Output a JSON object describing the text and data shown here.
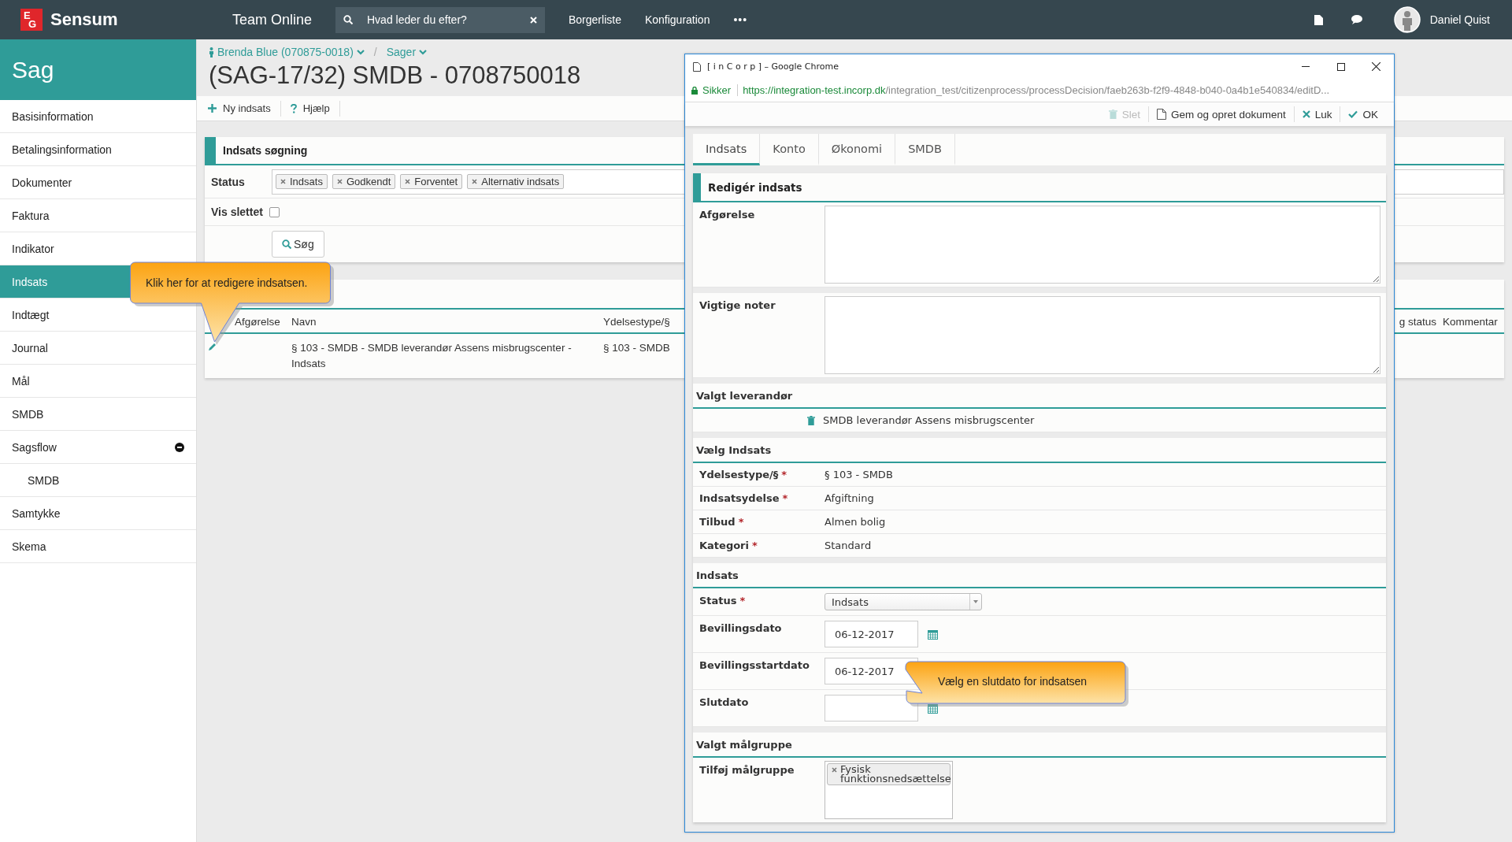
{
  "app": {
    "logo_mark": [
      "E",
      "G"
    ],
    "logo": "Sensum",
    "title": "Team Online"
  },
  "search": {
    "placeholder": "Hvad leder du efter?"
  },
  "nav": [
    {
      "label": "Borgerliste"
    },
    {
      "label": "Konfiguration"
    }
  ],
  "more": "•••",
  "user": {
    "name": "Daniel Quist"
  },
  "sidebar": {
    "title": "Sag",
    "items": [
      {
        "label": "Basisinformation",
        "selected": false
      },
      {
        "label": "Betalingsinformation",
        "selected": false
      },
      {
        "label": "Dokumenter",
        "selected": false
      },
      {
        "label": "Faktura",
        "selected": false
      },
      {
        "label": "Indikator",
        "selected": false
      },
      {
        "label": "Indsats",
        "selected": true
      },
      {
        "label": "Indtægt",
        "selected": false
      },
      {
        "label": "Journal",
        "selected": false
      },
      {
        "label": "Mål",
        "selected": false
      },
      {
        "label": "SMDB",
        "selected": false
      },
      {
        "label": "Sagsflow",
        "selected": false,
        "expanded": true,
        "children": [
          {
            "label": "SMDB",
            "selected": false
          }
        ]
      },
      {
        "label": "Samtykke",
        "selected": false
      },
      {
        "label": "Skema",
        "selected": false
      }
    ]
  },
  "breadcrumbs": [
    {
      "label": "Brenda Blue (070875-0018)",
      "kind": "person"
    },
    {
      "label": "Sager",
      "kind": "plain"
    }
  ],
  "breadcrumb_separator": "/",
  "page_title": "(SAG-17/32) SMDB - 0708750018",
  "toolbar": [
    {
      "label": "Ny indsats",
      "kind": "add"
    },
    {
      "label": "Hjælp",
      "kind": "help"
    }
  ],
  "search_panel": {
    "title": "Indsats søgning",
    "status_label": "Status",
    "status_tags": [
      "Indsats",
      "Godkendt",
      "Forventet",
      "Alternativ indsats"
    ],
    "show_deleted_label": "Vis slettet",
    "show_deleted": false,
    "search_button": "Søg"
  },
  "results": {
    "columns": [
      "Afgørelse",
      "Navn",
      "Ydelsestype/§",
      "g status",
      "Kommentar"
    ],
    "rows": [
      {
        "name": "§ 103 - SMDB - SMDB leverandør Assens misbrugscenter - Indsats",
        "type": "§ 103 - SMDB"
      }
    ]
  },
  "tooltips": [
    {
      "text": "Klik her for at redigere indsatsen."
    },
    {
      "text": "Vælg en slutdato for indsatsen"
    }
  ],
  "popup": {
    "title": "[ i n C o r p ] – Google Chrome",
    "secure_label": "Sikker",
    "url_host": "https://integration-test.incorp.dk",
    "url_path": "/integration_test/citizenprocess/processDecision/faeb263b-f2f9-4848-b040-0a4b1e540834/editD...",
    "actions": [
      {
        "label": "Slet",
        "kind": "delete",
        "disabled": true
      },
      {
        "label": "Gem og opret dokument",
        "kind": "document",
        "disabled": false
      },
      {
        "label": "Luk",
        "kind": "close",
        "disabled": false
      },
      {
        "label": "OK",
        "kind": "ok",
        "disabled": false
      }
    ],
    "tabs": [
      {
        "label": "Indsats",
        "selected": true
      },
      {
        "label": "Konto",
        "selected": false
      },
      {
        "label": "Økonomi",
        "selected": false
      },
      {
        "label": "SMDB",
        "selected": false
      }
    ],
    "required_mark": "*",
    "form": {
      "title": "Redigér indsats",
      "rows": [
        {
          "kind": "textarea",
          "label": "Afgørelse"
        },
        {
          "kind": "textarea",
          "label": "Vigtige noter"
        },
        {
          "kind": "heading",
          "label": "Valgt leverandør"
        },
        {
          "kind": "provider",
          "value": "SMDB leverandør Assens misbrugscenter"
        },
        {
          "kind": "heading",
          "label": "Vælg Indsats"
        },
        {
          "kind": "text",
          "label": "Ydelsestype/§",
          "required": true,
          "value": "§ 103 - SMDB"
        },
        {
          "kind": "text",
          "label": "Indsatsydelse",
          "required": true,
          "value": "Afgiftning"
        },
        {
          "kind": "text",
          "label": "Tilbud",
          "required": true,
          "value": "Almen bolig"
        },
        {
          "kind": "text",
          "label": "Kategori",
          "required": true,
          "value": "Standard"
        },
        {
          "kind": "heading",
          "label": "Indsats"
        },
        {
          "kind": "select",
          "label": "Status",
          "required": true,
          "value": "Indsats"
        },
        {
          "kind": "date",
          "label": "Bevillingsdato",
          "required": false,
          "value": "06-12-2017"
        },
        {
          "kind": "date",
          "label": "Bevillingsstartdato",
          "required": false,
          "value": "06-12-2017"
        },
        {
          "kind": "date",
          "label": "Slutdato",
          "required": false
        },
        {
          "kind": "heading",
          "label": "Valgt målgruppe"
        },
        {
          "kind": "tags",
          "label": "Tilføj målgruppe",
          "required": false,
          "tags": [
            "Fysisk funktionsnedsættelse"
          ]
        }
      ]
    }
  }
}
